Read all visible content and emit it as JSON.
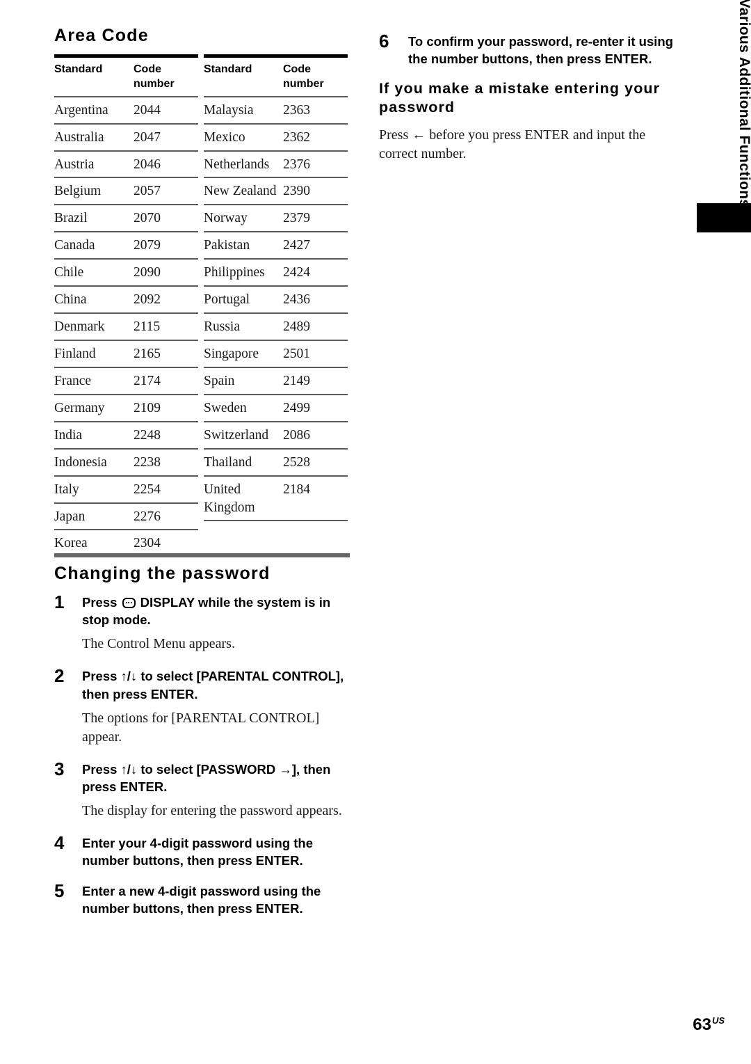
{
  "page": {
    "number": "63",
    "region_suffix": "US"
  },
  "side_tab": {
    "label": "Using Various Additional Functions"
  },
  "left_column": {
    "area_code": {
      "title": "Area Code",
      "columns": [
        "Standard",
        "Code number"
      ],
      "header_standard": "Standard",
      "header_code_line1": "Code",
      "header_code_line2": "number",
      "table_left": [
        {
          "country": "Argentina",
          "code": "2044"
        },
        {
          "country": "Australia",
          "code": "2047"
        },
        {
          "country": "Austria",
          "code": "2046"
        },
        {
          "country": "Belgium",
          "code": "2057"
        },
        {
          "country": "Brazil",
          "code": "2070"
        },
        {
          "country": "Canada",
          "code": "2079"
        },
        {
          "country": "Chile",
          "code": "2090"
        },
        {
          "country": "China",
          "code": "2092"
        },
        {
          "country": "Denmark",
          "code": "2115"
        },
        {
          "country": "Finland",
          "code": "2165"
        },
        {
          "country": "France",
          "code": "2174"
        },
        {
          "country": "Germany",
          "code": "2109"
        },
        {
          "country": "India",
          "code": "2248"
        },
        {
          "country": "Indonesia",
          "code": "2238"
        },
        {
          "country": "Italy",
          "code": "2254"
        },
        {
          "country": "Japan",
          "code": "2276"
        },
        {
          "country": "Korea",
          "code": "2304"
        }
      ],
      "table_right": [
        {
          "country": "Malaysia",
          "code": "2363"
        },
        {
          "country": "Mexico",
          "code": "2362"
        },
        {
          "country": "Netherlands",
          "code": "2376"
        },
        {
          "country": "New Zealand",
          "code": "2390"
        },
        {
          "country": "Norway",
          "code": "2379"
        },
        {
          "country": "Pakistan",
          "code": "2427"
        },
        {
          "country": "Philippines",
          "code": "2424"
        },
        {
          "country": "Portugal",
          "code": "2436"
        },
        {
          "country": "Russia",
          "code": "2489"
        },
        {
          "country": "Singapore",
          "code": "2501"
        },
        {
          "country": "Spain",
          "code": "2149"
        },
        {
          "country": "Sweden",
          "code": "2499"
        },
        {
          "country": "Switzerland",
          "code": "2086"
        },
        {
          "country": "Thailand",
          "code": "2528"
        },
        {
          "country": "United Kingdom",
          "code": "2184"
        }
      ]
    },
    "changing_password": {
      "title": "Changing the password",
      "steps": [
        {
          "num": "1",
          "text_before_icon": "Press ",
          "icon": "display-icon",
          "text_after_icon": " DISPLAY while the system is in stop mode.",
          "note": "The Control Menu appears."
        },
        {
          "num": "2",
          "text": "Press ↑/↓ to select [PARENTAL CONTROL], then press ENTER.",
          "note": "The options for [PARENTAL CONTROL] appear."
        },
        {
          "num": "3",
          "text": "Press ↑/↓ to select [PASSWORD →], then press ENTER.",
          "note": "The display for entering the password appears."
        },
        {
          "num": "4",
          "text": "Enter your 4-digit password using the number buttons, then press ENTER.",
          "note": ""
        },
        {
          "num": "5",
          "text": "Enter a new 4-digit password using the number buttons, then press ENTER.",
          "note": ""
        }
      ]
    }
  },
  "right_column": {
    "step6": {
      "num": "6",
      "text": "To confirm your password, re-enter it using the number buttons, then press ENTER."
    },
    "mistake_section": {
      "heading": "If you make a mistake entering your password",
      "body": "Press ← before you press ENTER and input the correct number."
    }
  }
}
